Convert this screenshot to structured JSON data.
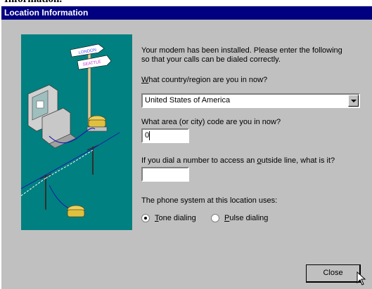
{
  "background_caption": "Information.",
  "window": {
    "title": "Location Information"
  },
  "intro": {
    "line1": "Your modem has been installed.  Please enter the following",
    "line2": "so that your calls can be dialed correctly."
  },
  "country": {
    "label_pre": "",
    "label_key": "W",
    "label_post": "hat country/region are you in now?",
    "selected": "United States of America"
  },
  "area": {
    "label": "What area (or city) code are you in now?",
    "value": "0"
  },
  "outside": {
    "label_pre": "If you dial a number to access an ",
    "label_key": "o",
    "label_post": "utside line, what is it?",
    "value": ""
  },
  "phone_system": {
    "label": "The phone system at this location uses:",
    "tone": {
      "key": "T",
      "rest": "one dialing",
      "selected": true
    },
    "pulse": {
      "key": "P",
      "rest": "ulse dialing",
      "selected": false
    }
  },
  "illustration": {
    "sign_top": "LONDON",
    "sign_bottom": "SEATTLE"
  },
  "buttons": {
    "close": "Close"
  },
  "colors": {
    "titlebar": "#000080",
    "face": "#c0c0c0",
    "teal": "#008080"
  }
}
